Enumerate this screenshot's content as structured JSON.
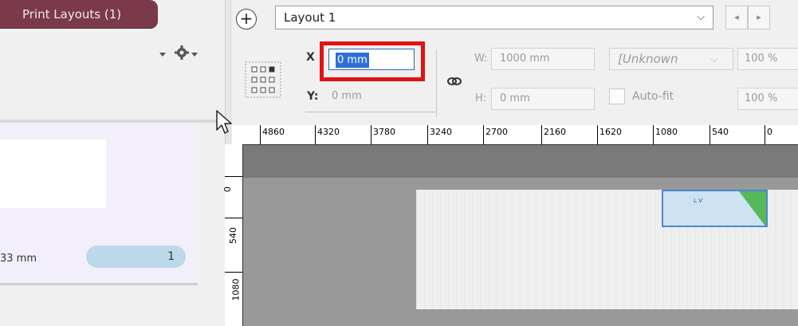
{
  "left_panel": {
    "tab_label": "Print Layouts (1)",
    "page_size_label": "33 mm",
    "page_number": "1"
  },
  "topbar": {
    "layout_select": "Layout 1",
    "nav_prev": "◂",
    "nav_next": "▸"
  },
  "properties": {
    "x_label": "X",
    "x_value": "0 mm",
    "y_label": "Y:",
    "y_value": "0 mm",
    "w_label": "W:",
    "w_value": "1000 mm",
    "h_label": "H:",
    "h_value": "0 mm",
    "units_value": "[Unknown",
    "autofit_label": "Auto-fit",
    "scale_1": "100 %",
    "scale_2": "100 %"
  },
  "ruler": {
    "top_labels": [
      "4860",
      "4320",
      "3780",
      "3240",
      "2700",
      "2160",
      "1620",
      "1080",
      "540",
      "0"
    ],
    "left_labels": [
      "0",
      "540",
      "1080"
    ]
  },
  "canvas": {
    "layout_item_text": "L Ѵ"
  },
  "colors": {
    "tab_bg": "#7a3a4a",
    "highlight": "#e01414",
    "selection": "#2f6fd6",
    "item_border": "#4a87d4",
    "item_corner": "#55b85a"
  }
}
